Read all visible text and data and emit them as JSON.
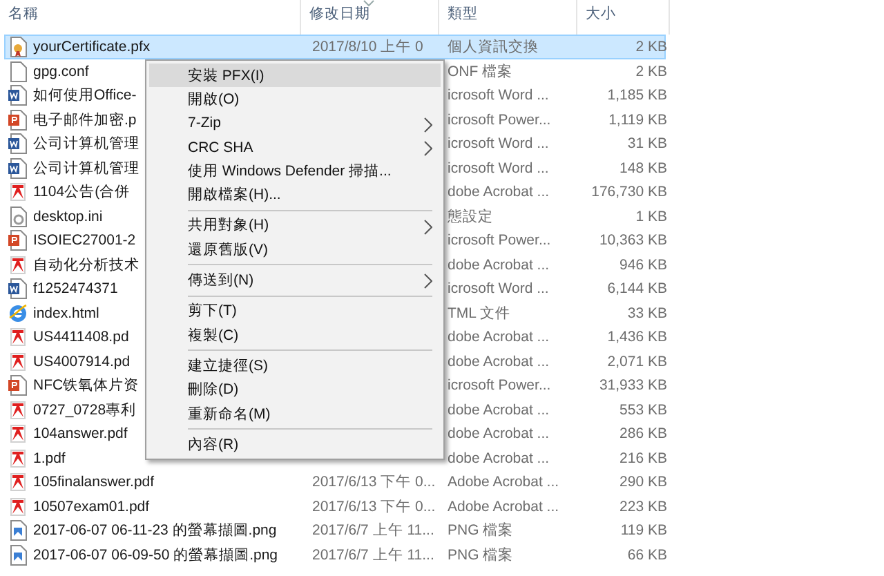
{
  "columns": [
    {
      "label": "名稱",
      "sorted": false
    },
    {
      "label": "修改日期",
      "sorted": true
    },
    {
      "label": "類型",
      "sorted": false
    },
    {
      "label": "大小",
      "sorted": false
    }
  ],
  "files": [
    {
      "kind": "certificate",
      "name": "yourCertificate.pfx",
      "date": "2017/8/10 上午 0",
      "type": "個人資訊交換",
      "size": "2 KB",
      "selected": true
    },
    {
      "kind": "file",
      "name": "gpg.conf",
      "type": "ONF 檔案",
      "size": "2 KB",
      "selected": false
    },
    {
      "kind": "word",
      "name": "如何使用Office-",
      "type": "icrosoft Word ...",
      "size": "1,185 KB",
      "selected": false
    },
    {
      "kind": "powerpoint",
      "name": "电子邮件加密.p",
      "type": "icrosoft Power...",
      "size": "1,119 KB",
      "selected": false
    },
    {
      "kind": "word",
      "name": "公司计算机管理",
      "type": "icrosoft Word ...",
      "size": "31 KB",
      "selected": false
    },
    {
      "kind": "word",
      "name": "公司计算机管理",
      "type": "icrosoft Word ...",
      "size": "148 KB",
      "selected": false
    },
    {
      "kind": "pdf",
      "name": "1104公告(合併",
      "type": "dobe Acrobat ...",
      "size": "176,730 KB",
      "selected": false
    },
    {
      "kind": "settings",
      "name": "desktop.ini",
      "type": "態設定",
      "size": "1 KB",
      "selected": false
    },
    {
      "kind": "powerpoint",
      "name": "ISOIEC27001-2",
      "type": "icrosoft Power...",
      "size": "10,363 KB",
      "selected": false
    },
    {
      "kind": "pdf",
      "name": "自动化分析技术",
      "type": "dobe Acrobat ...",
      "size": "946 KB",
      "selected": false
    },
    {
      "kind": "word",
      "name": "f1252474371",
      "type": "icrosoft Word ...",
      "size": "6,144 KB",
      "selected": false
    },
    {
      "kind": "html",
      "name": "index.html",
      "type": "TML 文件",
      "size": "33 KB",
      "selected": false
    },
    {
      "kind": "pdf",
      "name": "US4411408.pd",
      "type": "dobe Acrobat ...",
      "size": "1,436 KB",
      "selected": false
    },
    {
      "kind": "pdf",
      "name": "US4007914.pd",
      "type": "dobe Acrobat ...",
      "size": "2,071 KB",
      "selected": false
    },
    {
      "kind": "powerpoint",
      "name": "NFC铁氧体片资",
      "type": "icrosoft Power...",
      "size": "31,933 KB",
      "selected": false
    },
    {
      "kind": "pdf",
      "name": "0727_0728專利",
      "type": "dobe Acrobat ...",
      "size": "553 KB",
      "selected": false
    },
    {
      "kind": "pdf",
      "name": "104answer.pdf",
      "type": "dobe Acrobat ...",
      "size": "286 KB",
      "selected": false
    },
    {
      "kind": "pdf",
      "name": "1.pdf",
      "type": "dobe Acrobat ...",
      "size": "216 KB",
      "selected": false
    },
    {
      "kind": "pdf",
      "name": "105finalanswer.pdf",
      "date": "2017/6/13 下午 0...",
      "type": "Adobe Acrobat ...",
      "size": "290 KB",
      "selected": false
    },
    {
      "kind": "pdf",
      "name": "10507exam01.pdf",
      "date": "2017/6/13 下午 0...",
      "type": "Adobe Acrobat ...",
      "size": "223 KB",
      "selected": false
    },
    {
      "kind": "image",
      "name": "2017-06-07 06-11-23 的螢幕擷圖.png",
      "date": "2017/6/7 上午 11...",
      "type": "PNG 檔案",
      "size": "119 KB",
      "selected": false
    },
    {
      "kind": "image",
      "name": "2017-06-07 06-09-50 的螢幕擷圖.png",
      "date": "2017/6/7 上午 11...",
      "type": "PNG 檔案",
      "size": "66 KB",
      "selected": false
    }
  ],
  "context_menu": [
    {
      "kind": "item",
      "label": "安裝 PFX(I)",
      "selected": true,
      "submenu": false
    },
    {
      "kind": "item",
      "label": "開啟(O)",
      "selected": false,
      "submenu": false
    },
    {
      "kind": "item",
      "label": "7-Zip",
      "selected": false,
      "submenu": true
    },
    {
      "kind": "item",
      "label": "CRC SHA",
      "selected": false,
      "submenu": true
    },
    {
      "kind": "item",
      "label": "使用 Windows Defender 掃描...",
      "selected": false,
      "submenu": false
    },
    {
      "kind": "item",
      "label": "開啟檔案(H)...",
      "selected": false,
      "submenu": false
    },
    {
      "kind": "separator"
    },
    {
      "kind": "item",
      "label": "共用對象(H)",
      "selected": false,
      "submenu": true
    },
    {
      "kind": "item",
      "label": "還原舊版(V)",
      "selected": false,
      "submenu": false
    },
    {
      "kind": "separator"
    },
    {
      "kind": "item",
      "label": "傳送到(N)",
      "selected": false,
      "submenu": true
    },
    {
      "kind": "separator"
    },
    {
      "kind": "item",
      "label": "剪下(T)",
      "selected": false,
      "submenu": false
    },
    {
      "kind": "item",
      "label": "複製(C)",
      "selected": false,
      "submenu": false
    },
    {
      "kind": "separator"
    },
    {
      "kind": "item",
      "label": "建立捷徑(S)",
      "selected": false,
      "submenu": false
    },
    {
      "kind": "item",
      "label": "刪除(D)",
      "selected": false,
      "submenu": false
    },
    {
      "kind": "item",
      "label": "重新命名(M)",
      "selected": false,
      "submenu": false
    },
    {
      "kind": "separator"
    },
    {
      "kind": "item",
      "label": "內容(R)",
      "selected": false,
      "submenu": false
    }
  ]
}
